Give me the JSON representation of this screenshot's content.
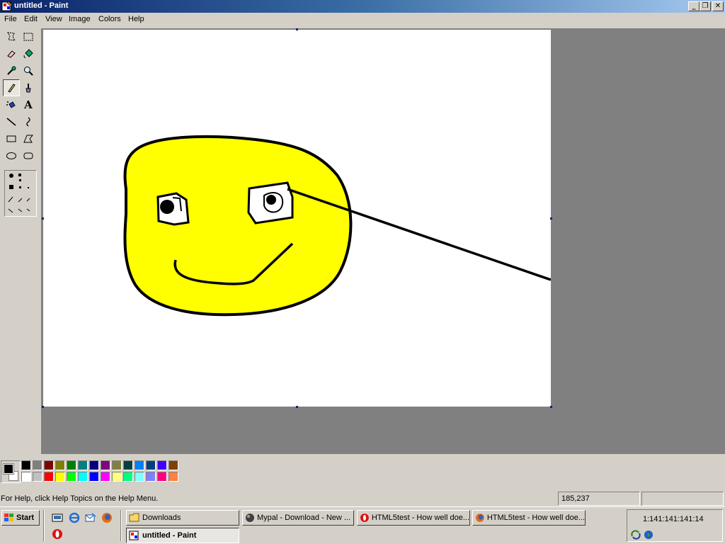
{
  "window": {
    "title": "untitled - Paint",
    "minimize": "_",
    "restore": "❐",
    "close": "✕"
  },
  "menu": [
    "File",
    "Edit",
    "View",
    "Image",
    "Colors",
    "Help"
  ],
  "tools": [
    "free-form-select-icon",
    "select-icon",
    "eraser-icon",
    "fill-bucket-icon",
    "pick-color-icon",
    "magnifier-icon",
    "pencil-icon",
    "brush-icon",
    "airbrush-icon",
    "text-icon",
    "line-icon",
    "curve-icon",
    "rectangle-icon",
    "polygon-icon",
    "ellipse-icon",
    "rounded-rectangle-icon"
  ],
  "text_tool_glyph": "A",
  "palette": {
    "foreground": "#000000",
    "background": "#ffffff",
    "colors_row1": [
      "#000000",
      "#808080",
      "#800000",
      "#808000",
      "#008000",
      "#008080",
      "#000080",
      "#800080",
      "#808040",
      "#004040",
      "#0080ff",
      "#004080",
      "#4000ff",
      "#804000"
    ],
    "colors_row2": [
      "#ffffff",
      "#c0c0c0",
      "#ff0000",
      "#ffff00",
      "#00ff00",
      "#00ffff",
      "#0000ff",
      "#ff00ff",
      "#ffff80",
      "#00ff80",
      "#80ffff",
      "#8080ff",
      "#ff0080",
      "#ff8040"
    ]
  },
  "status": {
    "help_text": "For Help, click Help Topics on the Help Menu.",
    "coordinates": "185,237",
    "size": ""
  },
  "taskbar": {
    "start_label": "Start",
    "tasks": [
      {
        "label": "Downloads",
        "icon": "folder-icon"
      },
      {
        "label": "Mypal - Download - New ...",
        "icon": "mypal-icon"
      },
      {
        "label": "HTML5test - How well doe...",
        "icon": "opera-icon"
      },
      {
        "label": "HTML5test - How well doe...",
        "icon": "firefox-icon"
      },
      {
        "label": "untitled - Paint",
        "icon": "paint-icon"
      }
    ],
    "clock": "1:141:141:141:14"
  },
  "colors": {
    "face_fill": "#ffff00",
    "outline": "#000000"
  }
}
